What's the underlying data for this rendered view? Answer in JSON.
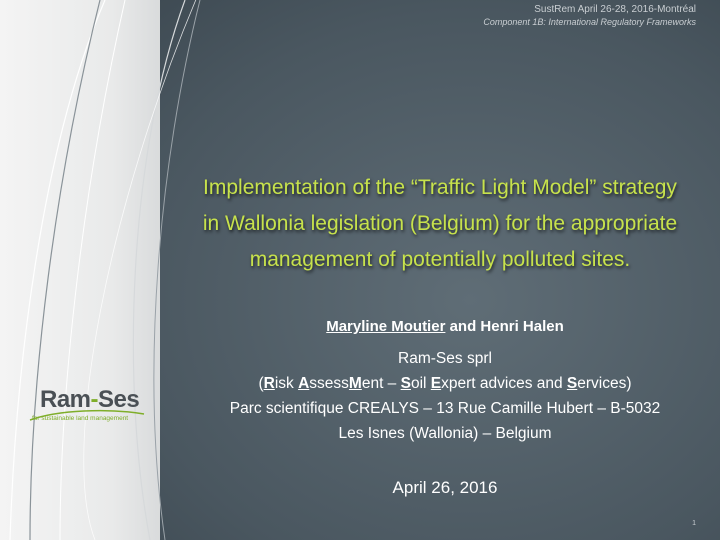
{
  "header": {
    "event": "SustRem April 26-28, 2016-Montréal",
    "component": "Component 1B: International Regulatory Frameworks"
  },
  "title": {
    "line1": "Implementation of the “Traffic Light Model” strategy",
    "line2": "in Wallonia legislation (Belgium) for the appropriate",
    "line3": "management of potentially polluted sites."
  },
  "authors": {
    "author1": "Maryline Moutier",
    "connector": " and ",
    "author2": "Henri Halen"
  },
  "company": {
    "name": "Ram-Ses sprl",
    "acronym_parts": [
      "(",
      "R",
      "isk ",
      "A",
      "ssess",
      "M",
      "ent – ",
      "S",
      "oil ",
      "E",
      "xpert advices and ",
      "S",
      "ervices)"
    ],
    "address_line1": "Parc scientifique CREALYS – 13 Rue Camille Hubert – B-5032",
    "address_line2": "Les Isnes (Wallonia) – Belgium"
  },
  "date": "April 26, 2016",
  "page_number": "1",
  "logo": {
    "name_part1": "Ram",
    "dash": "-",
    "name_part2": "Ses",
    "tagline": "for sustainable land management"
  },
  "colors": {
    "title": "#c7e24c",
    "logo_green": "#7fae2a",
    "background": "#4a5760"
  }
}
